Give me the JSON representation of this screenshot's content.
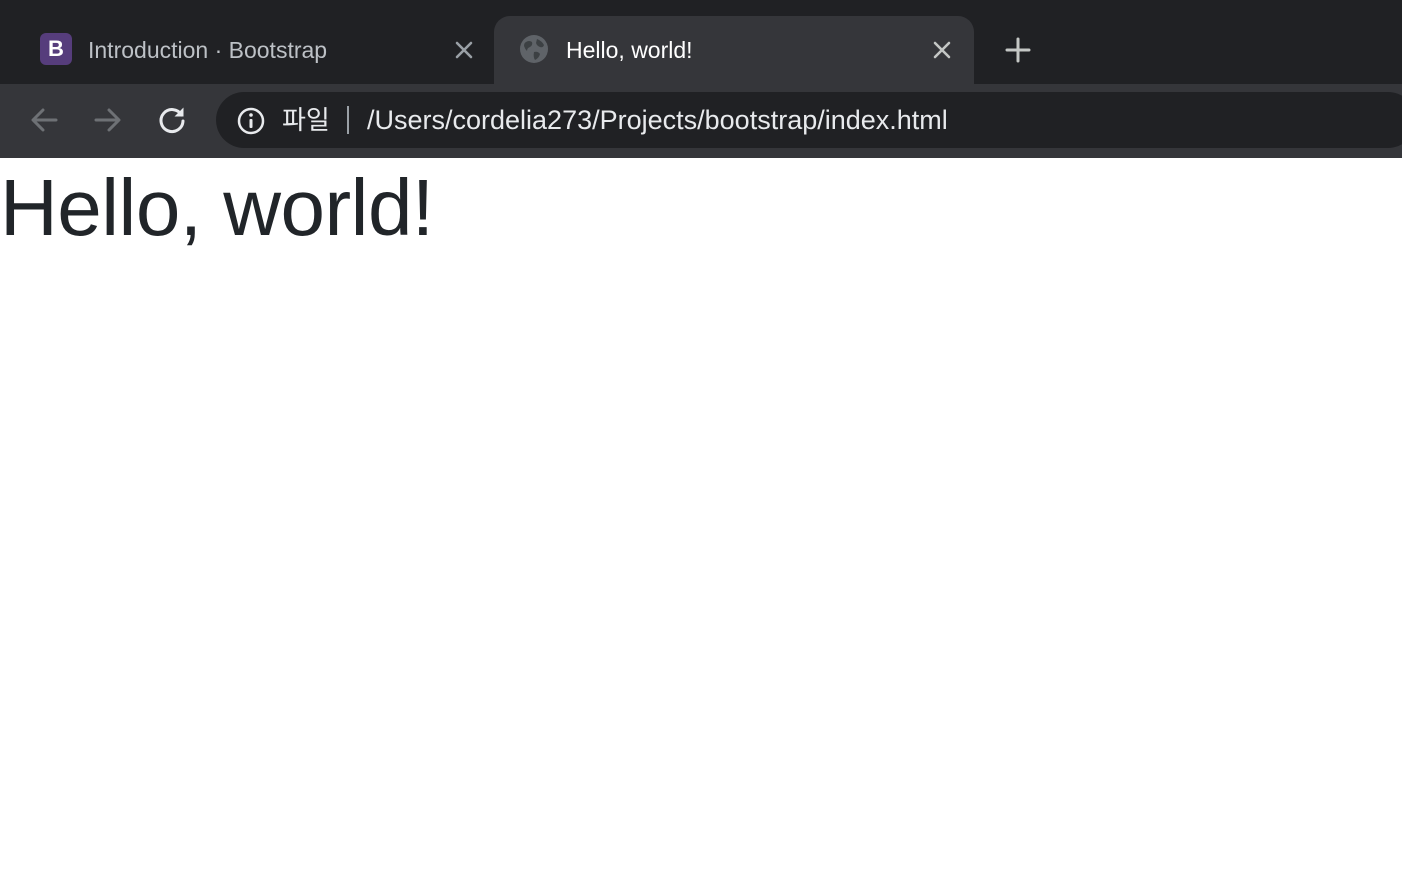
{
  "tabs": [
    {
      "title": "Introduction · Bootstrap",
      "favicon": "bootstrap-logo",
      "favicon_letter": "B",
      "active": false
    },
    {
      "title": "Hello, world!",
      "favicon": "globe-icon",
      "active": true
    }
  ],
  "toolbar": {
    "scheme_label": "파일",
    "url": "/Users/cordelia273/Projects/bootstrap/index.html"
  },
  "page": {
    "heading": "Hello, world!"
  },
  "colors": {
    "tabstrip_bg": "#202124",
    "toolbar_bg": "#35363a",
    "omnibox_bg": "#202124",
    "bootstrap_purple": "#563d7c",
    "heading_text": "#212529"
  }
}
